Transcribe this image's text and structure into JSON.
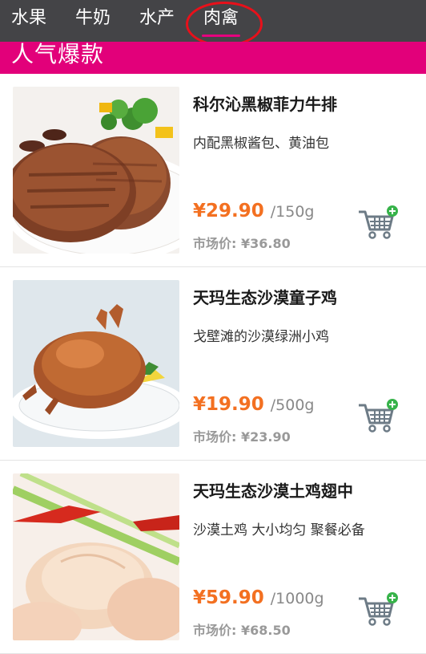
{
  "tabs": [
    {
      "label": "水果",
      "active": false
    },
    {
      "label": "牛奶",
      "active": false
    },
    {
      "label": "水产",
      "active": false
    },
    {
      "label": "肉禽",
      "active": true
    }
  ],
  "banner": {
    "title": "人气爆款"
  },
  "colors": {
    "tabbar_bg": "#444447",
    "banner_bg": "#e2007a",
    "price": "#f37021",
    "cart_plus": "#37b34a",
    "highlight_circle": "#e8101a"
  },
  "market_label": "市场价:",
  "products": [
    {
      "name": "科尔沁黑椒菲力牛排",
      "desc": "内配黑椒酱包、黄油包",
      "price": "¥29.90",
      "unit": "/150g",
      "market_price": "¥36.80",
      "image_icon": "steak-photo",
      "cart_icon": "cart-add-icon"
    },
    {
      "name": "天玛生态沙漠童子鸡",
      "desc": "戈壁滩的沙漠绿洲小鸡",
      "price": "¥19.90",
      "unit": "/500g",
      "market_price": "¥23.90",
      "image_icon": "roast-chicken-photo",
      "cart_icon": "cart-add-icon"
    },
    {
      "name": "天玛生态沙漠土鸡翅中",
      "desc": "沙漠土鸡 大小均匀 聚餐必备",
      "price": "¥59.90",
      "unit": "/1000g",
      "market_price": "¥68.50",
      "image_icon": "chicken-wings-photo",
      "cart_icon": "cart-add-icon"
    }
  ]
}
